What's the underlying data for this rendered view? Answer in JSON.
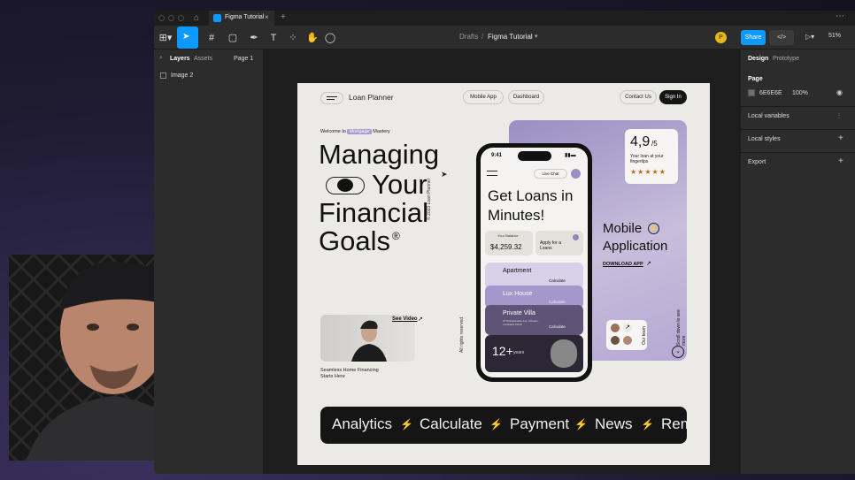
{
  "tab_title": "Figma Tutorial",
  "breadcrumb": {
    "drafts": "Drafts",
    "sep": "/",
    "file": "Figma Tutorial"
  },
  "toolbar": {
    "share": "Share",
    "zoom": "51%",
    "avatar": "P"
  },
  "left_panel": {
    "tabs": [
      "Layers",
      "Assets"
    ],
    "page": "Page 1",
    "layer": "Image 2"
  },
  "right_panel": {
    "tabs": [
      "Design",
      "Prototype"
    ],
    "page_label": "Page",
    "color_hex": "6E6E6E",
    "opacity": "100%",
    "sections": [
      "Local variables",
      "Local styles",
      "Export"
    ]
  },
  "design": {
    "logo": "Loan Planner",
    "nav": [
      "Mobile App",
      "Dashboard"
    ],
    "contact": "Contact Us",
    "signin": "Sign In",
    "welcome_pre": "Welcome to",
    "welcome_tag": "Mortgage",
    "welcome_post": "Mastery",
    "headline": [
      "Managing",
      "Your",
      "Financial",
      "Goals"
    ],
    "reg": "®",
    "copyright": "© 2023 Loan Planner",
    "rights": "All rights reserved.",
    "see_video": "See Video",
    "seamless": "Seamless Home Financing Starts Here",
    "rating": "4,9",
    "rating_of": "/5",
    "rating_text": "Your loan at your fingertips",
    "stars": "★★★★★",
    "mobile_app": "Mobile",
    "application": "Application",
    "download": "DOWNLOAD APP",
    "our_team": "Our team",
    "scroll": "Scroll down to see more",
    "phone": {
      "time": "9:41",
      "live_chat": "Live Chat",
      "title": "Get Loans in Minutes!",
      "balance_label": "Your Balance",
      "balance": "$4,259.32",
      "apply": "Apply for a Loans",
      "items": [
        "Apartment",
        "Lux House",
        "Private Villa"
      ],
      "villa_addr": "2779 Esplanade Ave, Orleans, Louisiana 70119",
      "calc": "Calculate",
      "years_num": "12+",
      "years": "years"
    },
    "ticker": [
      "Analytics",
      "Calculate",
      "Payment",
      "News",
      "Rem"
    ]
  },
  "colors": {
    "accent": "#0d99ff",
    "purple": "#9a8ec3",
    "avatar": "#e8b816"
  }
}
